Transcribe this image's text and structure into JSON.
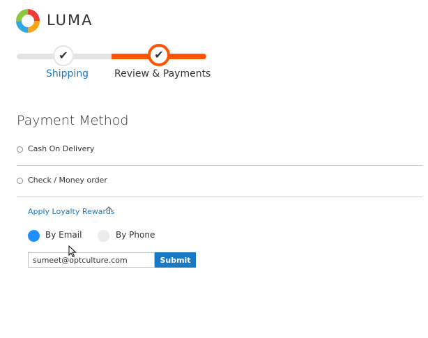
{
  "brand": {
    "name": "LUMA"
  },
  "progress": {
    "steps": [
      {
        "label": "Shipping",
        "state": "complete"
      },
      {
        "label": "Review & Payments",
        "state": "active"
      }
    ],
    "colors": {
      "active": "#ff5501",
      "inactive": "#e4e4e4",
      "link": "#1979c3"
    }
  },
  "payment": {
    "title": "Payment Method",
    "methods": [
      {
        "label": "Cash On Delivery",
        "selected": false
      },
      {
        "label": "Check / Money order",
        "selected": false
      }
    ],
    "loyalty": {
      "link_label": "Apply Loyalty Rewards",
      "options": [
        {
          "label": "By Email",
          "selected": true
        },
        {
          "label": "By Phone",
          "selected": false
        }
      ],
      "input_value": "sumeet@optculture.com",
      "submit_label": "Submit"
    }
  },
  "icons": {
    "logo": "luma-logo-icon",
    "step_check": "checkmark-icon",
    "chevron": "chevron-up-icon",
    "cursor": "mouse-pointer-icon"
  }
}
